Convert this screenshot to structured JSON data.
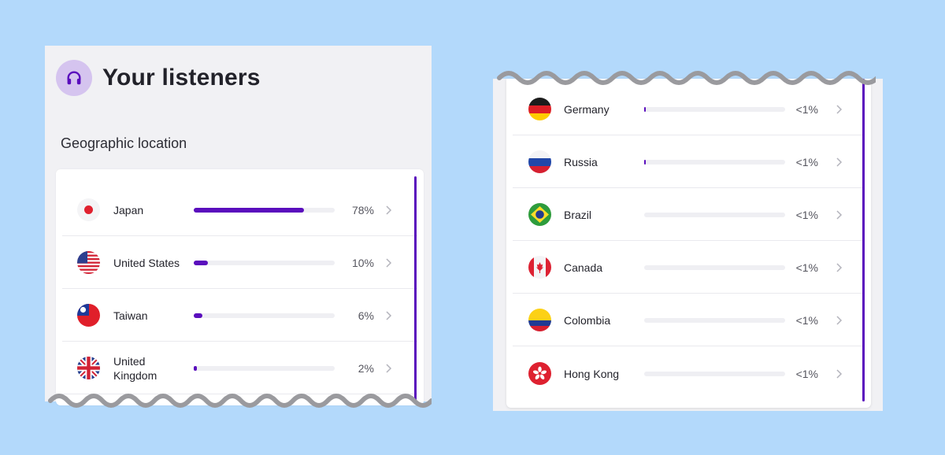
{
  "header": {
    "title": "Your listeners",
    "icon": "headphones-icon",
    "icon_bg": "#d5c4ef"
  },
  "section": {
    "title": "Geographic location"
  },
  "accent_color": "#5a0ebd",
  "countries_visible_left": [
    {
      "name": "Japan",
      "percent_label": "78%",
      "share": 0.78,
      "flag": "flag-japan-icon"
    },
    {
      "name": "United States",
      "percent_label": "10%",
      "share": 0.1,
      "flag": "flag-united-states-icon"
    },
    {
      "name": "Taiwan",
      "percent_label": "6%",
      "share": 0.06,
      "flag": "flag-taiwan-icon"
    },
    {
      "name": "United Kingdom",
      "percent_label": "2%",
      "share": 0.02,
      "flag": "flag-united-kingdom-icon"
    }
  ],
  "countries_visible_right": [
    {
      "name": "Germany",
      "percent_label": "<1%",
      "share": 0.005,
      "flag": "flag-germany-icon"
    },
    {
      "name": "Russia",
      "percent_label": "<1%",
      "share": 0.005,
      "flag": "flag-russia-icon"
    },
    {
      "name": "Brazil",
      "percent_label": "<1%",
      "share": 0,
      "flag": "flag-brazil-icon"
    },
    {
      "name": "Canada",
      "percent_label": "<1%",
      "share": 0,
      "flag": "flag-canada-icon"
    },
    {
      "name": "Colombia",
      "percent_label": "<1%",
      "share": 0,
      "flag": "flag-colombia-icon"
    },
    {
      "name": "Hong Kong",
      "percent_label": "<1%",
      "share": 0,
      "flag": "flag-hong-kong-icon"
    }
  ]
}
